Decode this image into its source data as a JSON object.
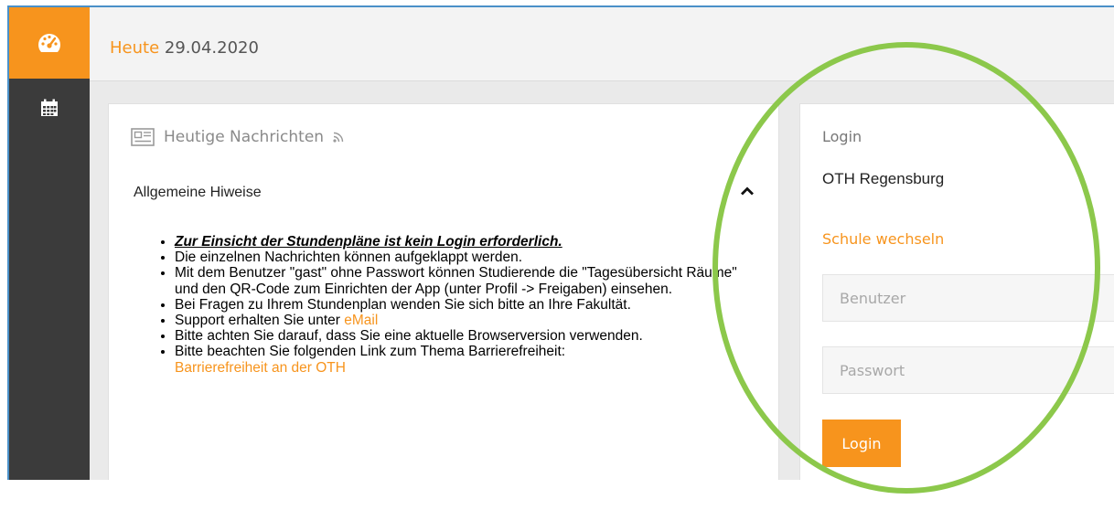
{
  "colors": {
    "accent": "#f7941d",
    "sidebar": "#3b3b3b",
    "annotation_circle": "#8cc84b"
  },
  "icons": {
    "dashboard": "gauge-icon",
    "calendar": "calendar-icon",
    "news": "newspaper-icon",
    "rss": "rss-icon",
    "collapse": "chevron-up-icon"
  },
  "header": {
    "today_label": "Heute",
    "date": "29.04.2020"
  },
  "news": {
    "title": "Heutige Nachrichten",
    "section": "Allgemeine Hiweise",
    "item1": "Zur Einsicht der Stundenpläne ist kein Login erforderlich.",
    "item2": "Die einzelnen Nachrichten können aufgeklappt werden.",
    "item3": "Mit dem Benutzer \"gast\" ohne Passwort können Studierende die \"Tagesübersicht Räume\" und den QR-Code zum Einrichten der App (unter Profil -> Freigaben) einsehen.",
    "item4": "Bei Fragen zu Ihrem Stundenplan wenden Sie sich bitte an Ihre Fakultät.",
    "item5_prefix": "Support erhalten Sie unter ",
    "item5_link": "eMail",
    "item6": "Bitte achten Sie darauf, dass Sie eine aktuelle Browserversion verwenden.",
    "item7": "Bitte beachten Sie folgenden Link zum Thema Barrierefreiheit:",
    "item7_link": "Barrierefreiheit an der OTH"
  },
  "login": {
    "title": "Login",
    "school": "OTH Regensburg",
    "change_school": "Schule wechseln",
    "user_placeholder": "Benutzer",
    "pass_placeholder": "Passwort",
    "button": "Login"
  }
}
